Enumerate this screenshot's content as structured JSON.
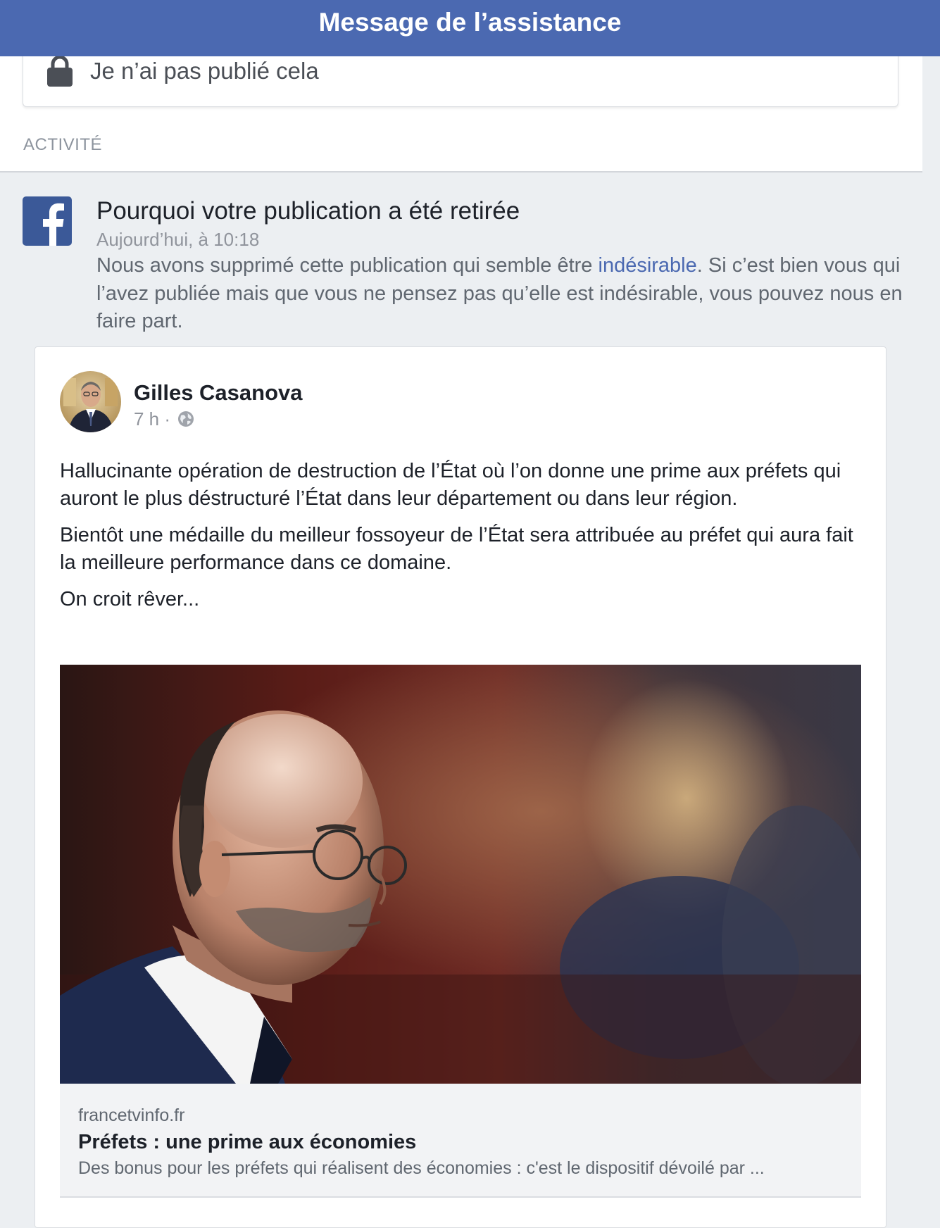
{
  "header": {
    "title": "Message de l’assistance"
  },
  "action": {
    "label": "Je n’ai pas publié cela",
    "icon": "lock-icon"
  },
  "section": {
    "title": "ACTIVITÉ"
  },
  "notification": {
    "icon": "facebook-logo-icon",
    "title": "Pourquoi votre publication a été retirée",
    "timestamp": "Aujourd’hui, à 10:18",
    "body_before": "Nous avons supprimé cette publication qui semble être ",
    "body_link": "indésirable",
    "body_after": ". Si c’est bien vous qui l’avez publiée mais que vous ne pensez pas qu’elle est indésirable, vous pouvez nous en faire part."
  },
  "post": {
    "author": "Gilles Casanova",
    "time": "7 h ·",
    "privacy_icon": "globe-icon",
    "paragraphs": [
      "Hallucinante opération de destruction de l’État où l’on donne une prime aux préfets qui auront le plus déstructuré l’État dans leur département ou dans leur région.",
      "Bientôt une médaille du meilleur fossoyeur de l’État sera attribuée au préfet qui aura fait la meilleure performance dans ce domaine.",
      "On croit rêver..."
    ],
    "link": {
      "domain": "francetvinfo.fr",
      "title": "Préfets : une prime aux économies",
      "description": "Des bonus pour les préfets qui réalisent des économies : c'est le dispositif dévoilé par ..."
    }
  },
  "colors": {
    "brand": "#4b69b1",
    "background": "#eceff2",
    "link": "#4b69b1"
  }
}
